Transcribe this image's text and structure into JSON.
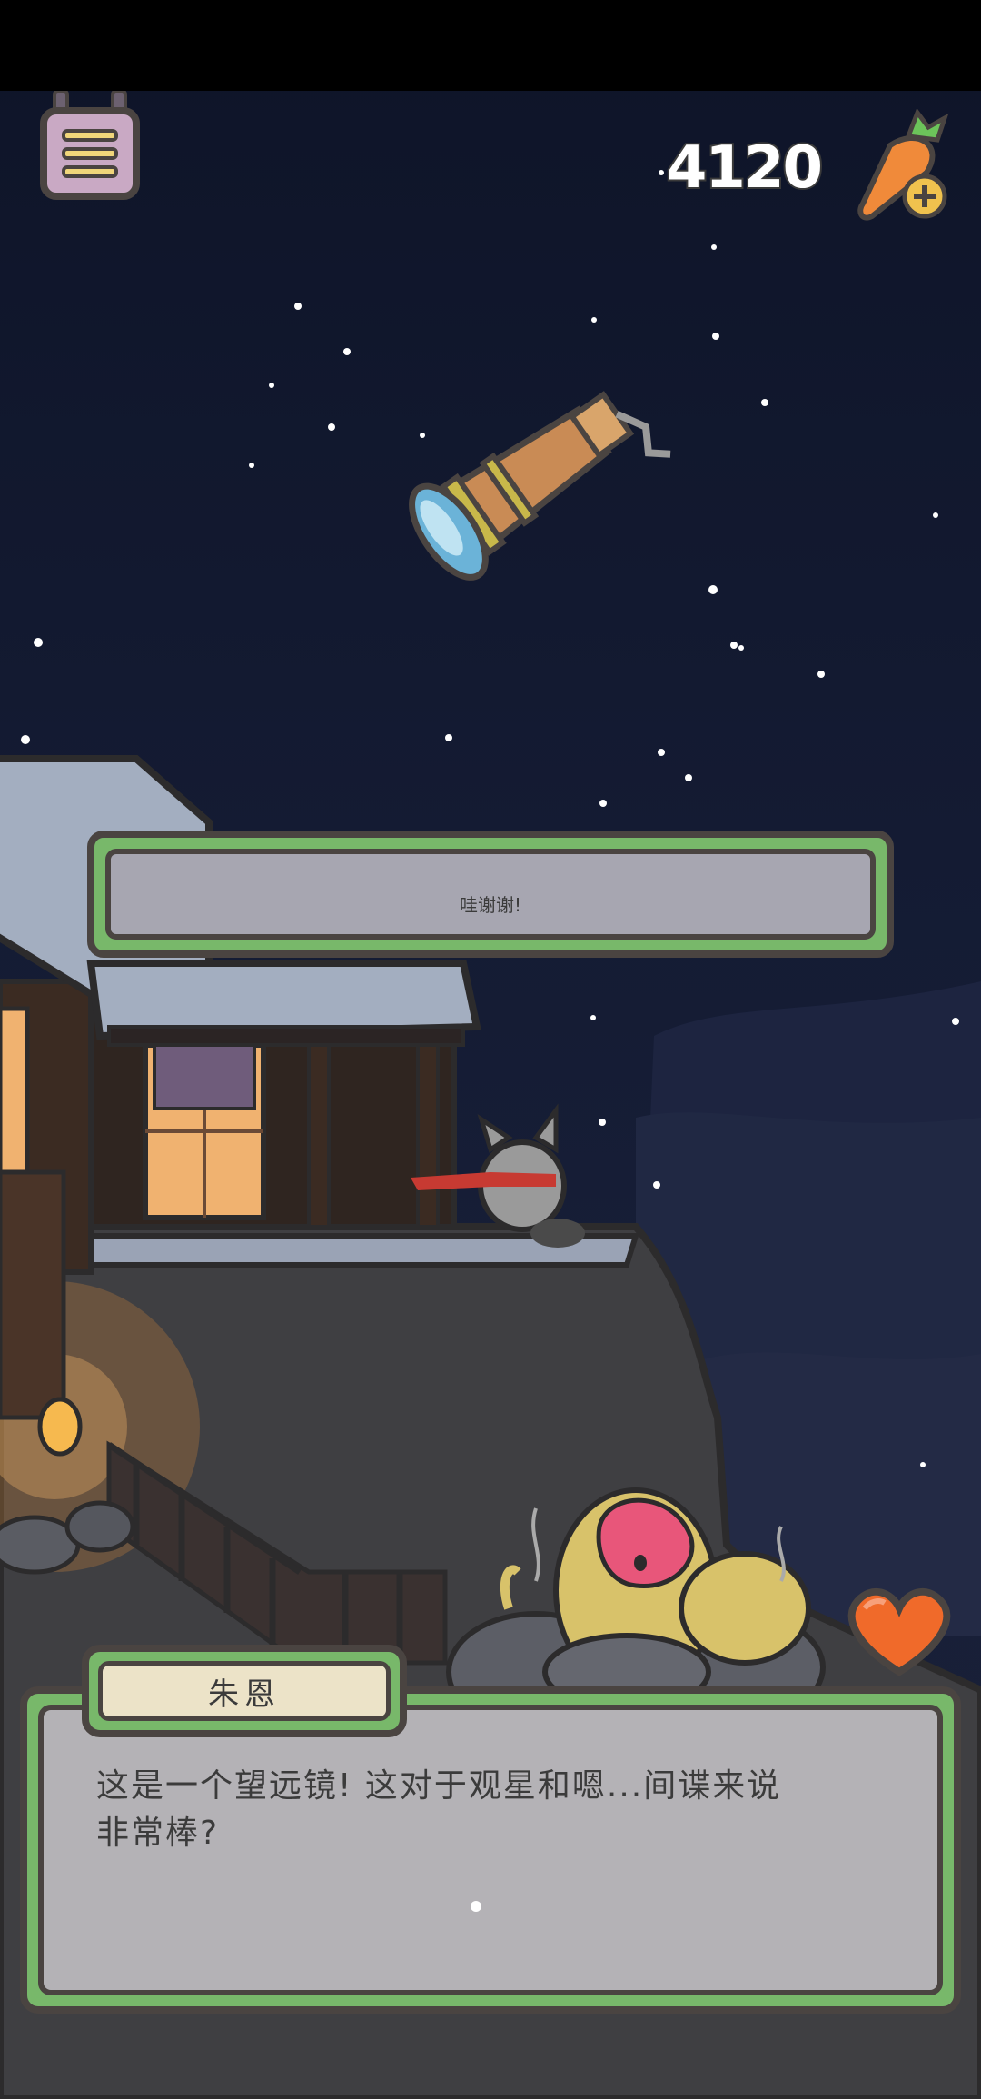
{
  "hud": {
    "menu_icon": "menu-list-icon",
    "currency_value": "4120",
    "currency_icon": "carrot-plus-icon"
  },
  "banner": {
    "text": "哇谢谢!"
  },
  "dialog": {
    "speaker": "朱恩",
    "text": "这是一个望远镜! 这对于观星和嗯...间谍来说\n非常棒?"
  },
  "colors": {
    "sky": "#141b33",
    "panel_green": "#78b86a",
    "panel_border": "#4a4441",
    "panel_fill": "#b4b2b6",
    "name_fill": "#ece3c8",
    "heart": "#f06a2a"
  },
  "scene": {
    "item": "telescope",
    "characters": [
      "grey rabbit with red scarf",
      "snow monkey in hot spring"
    ]
  }
}
